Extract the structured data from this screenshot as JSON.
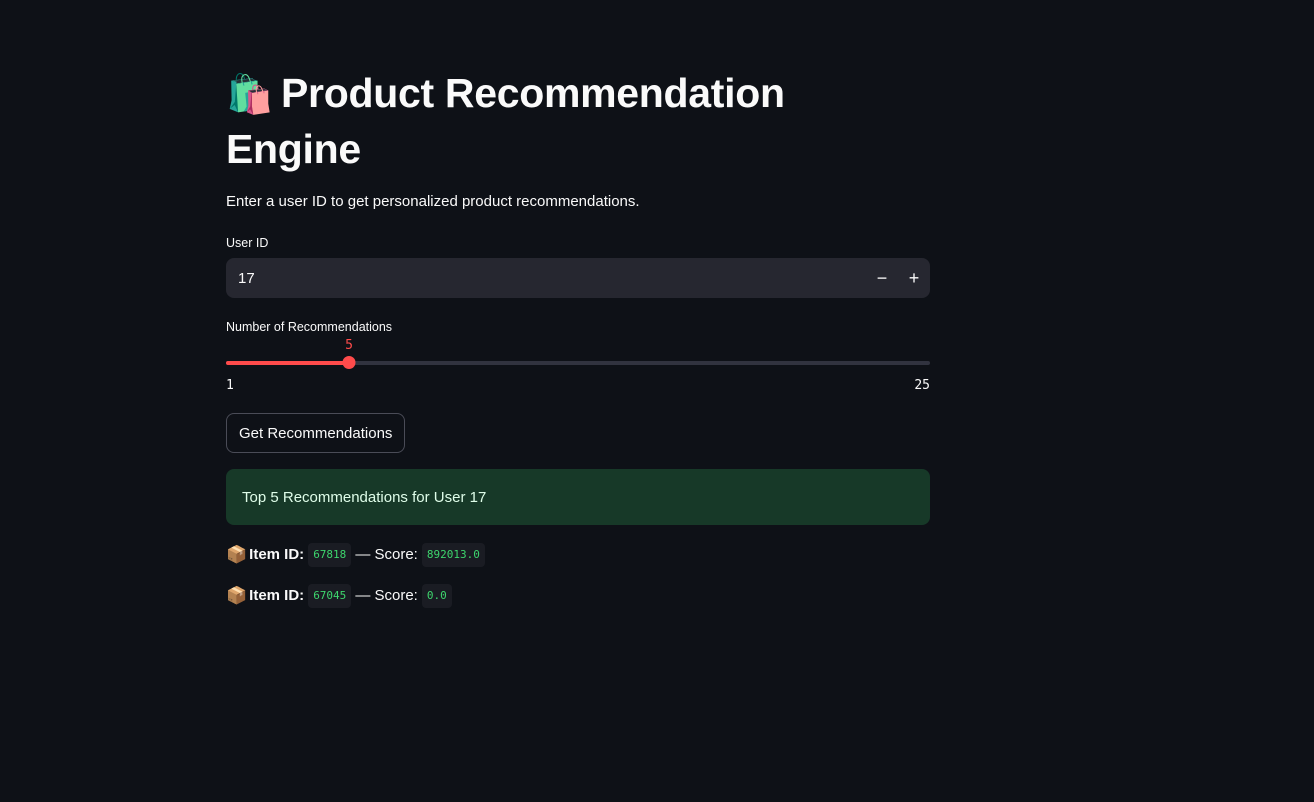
{
  "header": {
    "emoji": "🛍️",
    "title": "Product Recommendation Engine",
    "subtitle": "Enter a user ID to get personalized product recommendations."
  },
  "user_id_input": {
    "label": "User ID",
    "value": "17",
    "decrement_label": "−",
    "increment_label": "+"
  },
  "slider": {
    "label": "Number of Recommendations",
    "value": 5,
    "min": 1,
    "max": 25,
    "accent_color": "#ff4b4b"
  },
  "button": {
    "label": "Get Recommendations"
  },
  "success_message": "Top 5 Recommendations for User 17",
  "recommendations": [
    {
      "icon": "📦",
      "item_label": "Item ID:",
      "item_id": "67818",
      "separator": "— Score:",
      "score": "892013.0"
    },
    {
      "icon": "📦",
      "item_label": "Item ID:",
      "item_id": "67045",
      "separator": "— Score:",
      "score": "0.0"
    }
  ]
}
